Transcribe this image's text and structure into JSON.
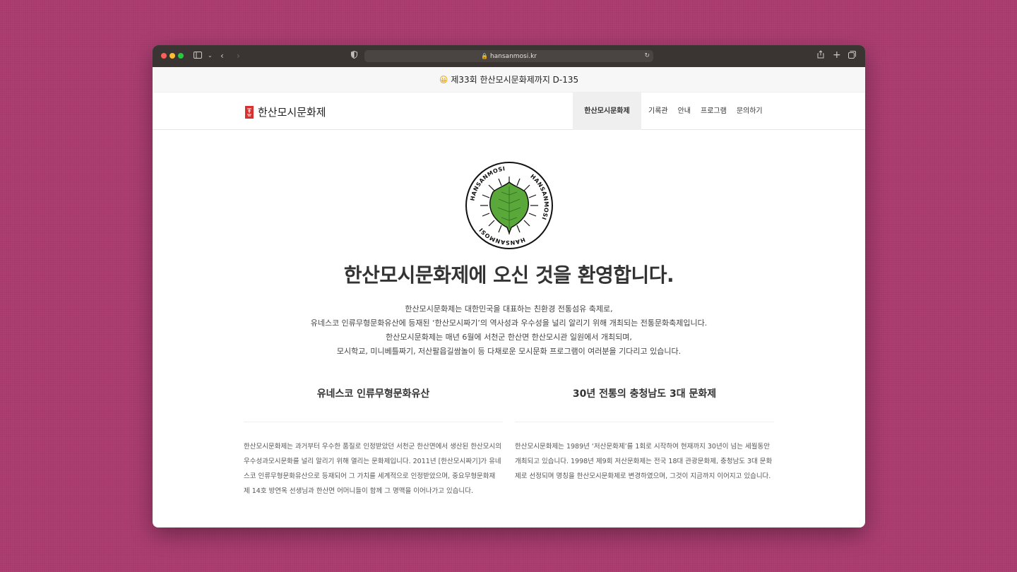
{
  "browser": {
    "url": "hansanmosi.kr",
    "lock_icon": "lock-icon",
    "reload_icon": "reload-icon"
  },
  "announcement": {
    "emoji": "😀",
    "text": "제33회 한산모시문화제까지 D-135"
  },
  "header": {
    "logo_mark": "한산",
    "logo_text": "한산모시문화제",
    "nav": [
      {
        "label": "한산모시문화제",
        "active": true
      },
      {
        "label": "기록관"
      },
      {
        "label": "안내"
      },
      {
        "label": "프로그램"
      },
      {
        "label": "문의하기"
      }
    ]
  },
  "hero": {
    "emblem_text": "HANSANMOSI",
    "emblem_leaf_color": "#5aa83a",
    "headline": "한산모시문화제에 오신 것을 환영합니다.",
    "intro_lines": [
      "한산모시문화제는 대한민국을 대표하는 친환경 전통섬유 축제로,",
      "유네스코 인류무형문화유산에 등재된 ‘한산모시짜기’의 역사성과 우수성을 널리 알리기 위해 개최되는 전통문화축제입니다.",
      "한산모시문화제는 매년 6월에 서천군 한산면 한산모시관 일원에서 개최되며,",
      "모시학교, 미니베틀짜기, 저산팔읍길쌈놀이 등 다채로운 모시문화 프로그램이 여러분을 기다리고 있습니다."
    ]
  },
  "columns": [
    {
      "title": "유네스코 인류무형문화유산",
      "body": "한산모시문화제는 과거부터 우수한 품질로 인정받았던 서천군 한산면에서 생산된 한산모시의 우수성과모시문화를 널리 알리기 위해 열리는 문화제입니다. 2011년 [한산모시짜기]가 유네스코 인류무형문화유산으로 등재되어 그 가치를 세계적으로 인정받았으며, 중요무형문화재 제 14호 방연옥 선생님과 한산면 어머니들이 함께 그 명맥을 이어나가고 있습니다."
    },
    {
      "title": "30년 전통의 충청남도 3대 문화제",
      "body": "한산모시문화제는 1989년 ‘저산문화제’를 1회로 시작하여 현재까지 30년이 넘는 세월동안 개최되고 있습니다. 1998년 제9회 저산문화제는 전국 18대 관광문화제, 충청남도 3대 문화제로 선정되며 명칭을 한산모시문화제로 변경하였으며, 그것이 지금까지 이어지고 있습니다."
    }
  ]
}
